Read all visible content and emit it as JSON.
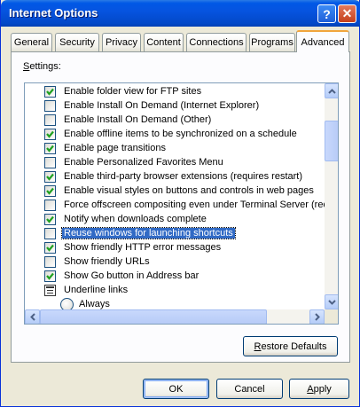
{
  "window": {
    "title": "Internet Options",
    "help_glyph": "?",
    "close_glyph": "✕"
  },
  "tabs": [
    {
      "label": "General",
      "active": false
    },
    {
      "label": "Security",
      "active": false
    },
    {
      "label": "Privacy",
      "active": false
    },
    {
      "label": "Content",
      "active": false
    },
    {
      "label": "Connections",
      "active": false
    },
    {
      "label": "Programs",
      "active": false
    },
    {
      "label": "Advanced",
      "active": true
    }
  ],
  "settings": {
    "label_accel": "S",
    "label_rest": "ettings:",
    "items": [
      {
        "type": "checkbox",
        "checked": true,
        "label": "Enable folder view for FTP sites"
      },
      {
        "type": "checkbox",
        "checked": false,
        "label": "Enable Install On Demand (Internet Explorer)"
      },
      {
        "type": "checkbox",
        "checked": false,
        "label": "Enable Install On Demand (Other)"
      },
      {
        "type": "checkbox",
        "checked": true,
        "label": "Enable offline items to be synchronized on a schedule"
      },
      {
        "type": "checkbox",
        "checked": true,
        "label": "Enable page transitions"
      },
      {
        "type": "checkbox",
        "checked": false,
        "label": "Enable Personalized Favorites Menu"
      },
      {
        "type": "checkbox",
        "checked": true,
        "label": "Enable third-party browser extensions (requires restart)"
      },
      {
        "type": "checkbox",
        "checked": true,
        "label": "Enable visual styles on buttons and controls in web pages"
      },
      {
        "type": "checkbox",
        "checked": false,
        "label": "Force offscreen compositing even under Terminal Server (requ"
      },
      {
        "type": "checkbox",
        "checked": true,
        "label": "Notify when downloads complete"
      },
      {
        "type": "checkbox",
        "checked": false,
        "label": "Reuse windows for launching shortcuts",
        "selected": true
      },
      {
        "type": "checkbox",
        "checked": true,
        "label": "Show friendly HTTP error messages"
      },
      {
        "type": "checkbox",
        "checked": false,
        "label": "Show friendly URLs"
      },
      {
        "type": "checkbox",
        "checked": true,
        "label": "Show Go button in Address bar"
      },
      {
        "type": "group",
        "label": "Underline links"
      },
      {
        "type": "radio",
        "checked": false,
        "label": "Always"
      }
    ]
  },
  "buttons": {
    "restore_accel": "R",
    "restore_rest": "estore Defaults",
    "ok": "OK",
    "cancel": "Cancel",
    "apply_accel": "A",
    "apply_rest": "pply"
  },
  "colors": {
    "title_bar": "#0054e3",
    "selection": "#316ac5",
    "check": "#21a121",
    "active_tab_accent": "#f1a53c",
    "dialog_bg": "#ece9d8"
  }
}
